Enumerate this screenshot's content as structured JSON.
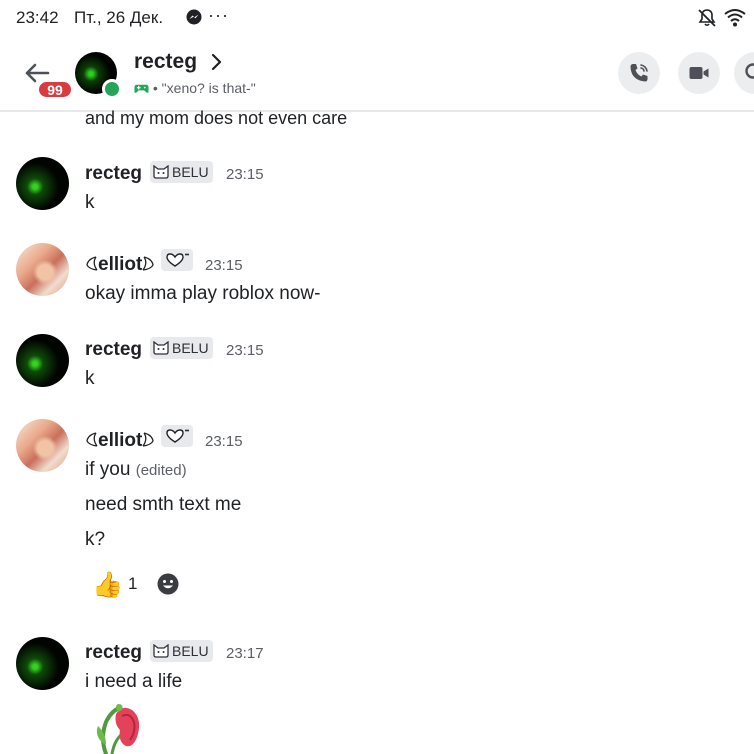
{
  "status_bar": {
    "time": "23:42",
    "date": "Пт., 26 Дек.",
    "overflow": "···",
    "icons": [
      "messenger-icon",
      "mute-icon",
      "wifi-icon"
    ]
  },
  "header": {
    "unread_badge": "99",
    "username": "recteg",
    "activity": "• \"xeno? is that-\"",
    "buttons": [
      "phone-icon",
      "video-camera-icon",
      "search-icon"
    ]
  },
  "messages": {
    "previous_text": "and my mom does not even care",
    "m1": {
      "author": "recteg",
      "tag": "BELU",
      "time": "23:15",
      "text": "k"
    },
    "m2": {
      "author": "elliot",
      "time": "23:15",
      "text": "okay imma play roblox now-"
    },
    "m3": {
      "author": "recteg",
      "tag": "BELU",
      "time": "23:15",
      "text": "k"
    },
    "m4": {
      "author": "elliot",
      "time": "23:15",
      "line1": "if you",
      "edited": "(edited)",
      "line2": "need smth text me",
      "line3": "k?",
      "reaction": {
        "emoji": "👍",
        "count": "1"
      }
    },
    "m5": {
      "author": "recteg",
      "tag": "BELU",
      "time": "23:17",
      "text": "i need a life"
    }
  },
  "colors": {
    "badge_red": "#d83c3e",
    "online_green": "#23a55a",
    "tag_bg": "#e8e9ec",
    "timestamp": "#5c5e66"
  }
}
